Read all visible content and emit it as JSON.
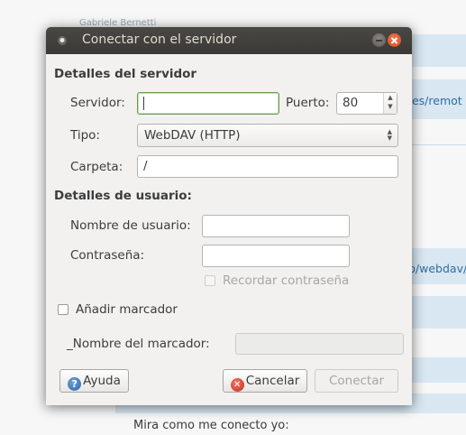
{
  "background": {
    "author": "Gabriele Bernetti",
    "link_1": ".es/remot",
    "link_2": "p/webdav/",
    "comment": "Mira como me conecto yo:"
  },
  "dialog": {
    "title": "Conectar con el servidor",
    "server_section": {
      "heading": "Detalles del servidor",
      "server_label": "Servidor:",
      "server_value": "",
      "port_label": "Puerto:",
      "port_value": "80",
      "type_label": "Tipo:",
      "type_selected": "WebDAV (HTTP)",
      "folder_label": "Carpeta:",
      "folder_value": "/"
    },
    "user_section": {
      "heading": "Detalles de usuario:",
      "username_label": "Nombre de usuario:",
      "username_value": "",
      "password_label": "Contraseña:",
      "password_value": "",
      "remember_label": "Recordar contraseña",
      "remember_checked": false
    },
    "bookmark": {
      "add_label": "Añadir marcador",
      "add_checked": false,
      "name_label": "_Nombre del marcador:",
      "name_value": ""
    },
    "buttons": {
      "help": "Ayuda",
      "cancel": "Cancelar",
      "connect": "Conectar"
    }
  }
}
